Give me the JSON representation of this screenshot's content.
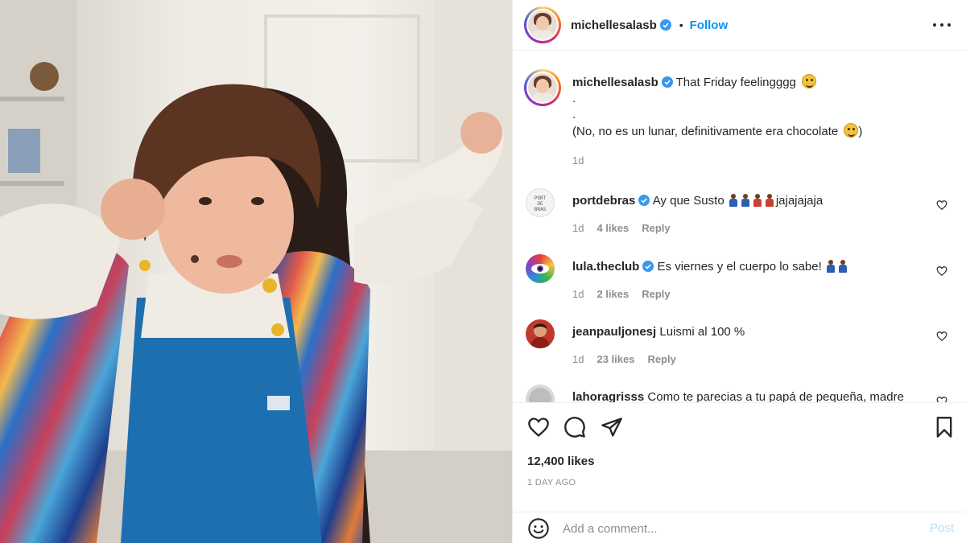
{
  "post": {
    "username": "michellesalasb",
    "follow_label": "Follow",
    "separator": "•"
  },
  "caption": {
    "username": "michellesalasb",
    "line1": "That Friday feelingggg",
    "line2": ".",
    "line3": ".",
    "line4": "(No, no es un lunar, definitivamente era chocolate",
    "line4_end": ")",
    "time": "1d"
  },
  "comments": [
    {
      "username": "portdebras",
      "text": "Ay que Susto",
      "text_end": "jajajajaja",
      "time": "1d",
      "likes": "4 likes",
      "reply": "Reply",
      "avatar_text": "PORT DE BRAS"
    },
    {
      "username": "lula.theclub",
      "text": "Es viernes y el cuerpo lo sabe!",
      "time": "1d",
      "likes": "2 likes",
      "reply": "Reply"
    },
    {
      "username": "jeanpauljonesj",
      "text": "Luismi al 100 %",
      "time": "1d",
      "likes": "23 likes",
      "reply": "Reply"
    },
    {
      "username": "lahoragrisss",
      "text": "Como te parecias a tu papá de pequeña, madre"
    }
  ],
  "actions": {
    "likes": "12,400 likes",
    "time_ago": "1 DAY AGO"
  },
  "add_comment": {
    "placeholder": "Add a comment...",
    "post_label": "Post"
  },
  "colors": {
    "accent": "#0095f6",
    "post_disabled": "#b2dffc",
    "muted": "#8e8e8e"
  }
}
